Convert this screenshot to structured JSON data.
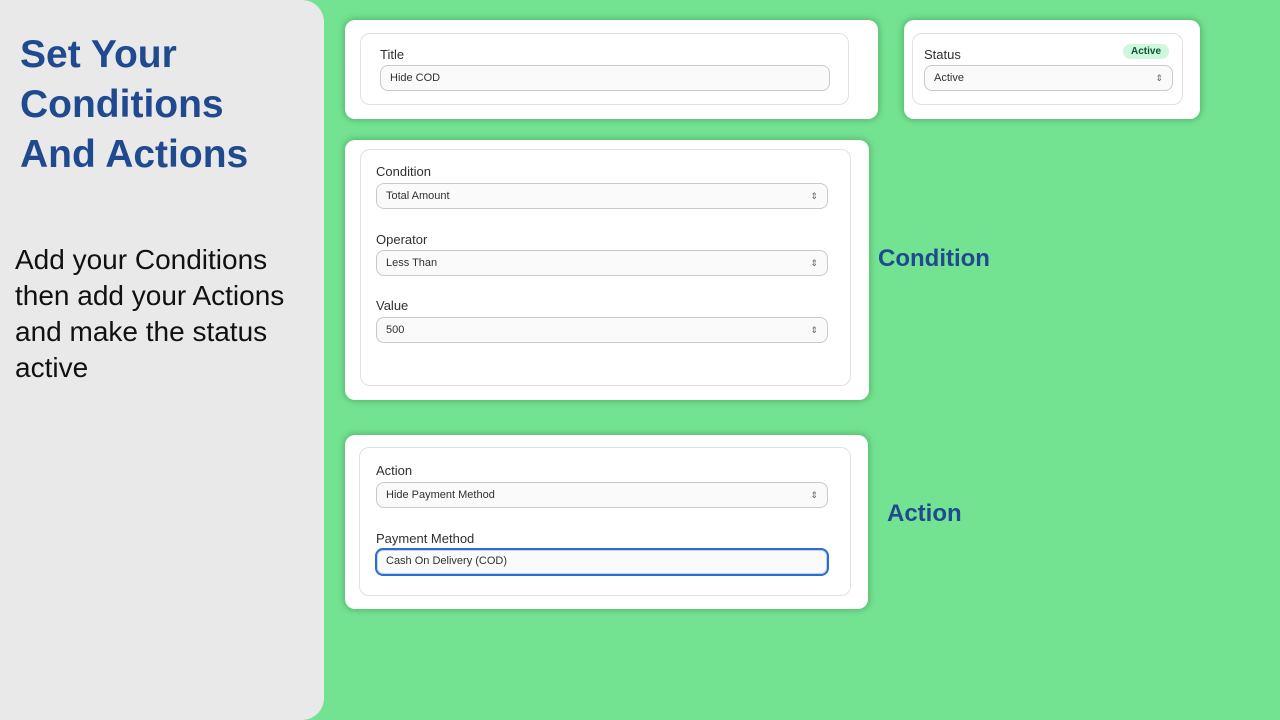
{
  "intro": {
    "heading_lines": [
      "Set Your",
      "Conditions",
      "And Actions"
    ],
    "description": "Add your Conditions then add your Actions and make the status active"
  },
  "title_card": {
    "label": "Title",
    "value": "Hide COD"
  },
  "status_card": {
    "label": "Status",
    "badge": "Active",
    "value": "Active",
    "badge_color": "#cdf8dd"
  },
  "condition_card": {
    "side_label": "Condition",
    "fields": [
      {
        "label": "Condition",
        "value": "Total Amount"
      },
      {
        "label": "Operator",
        "value": "Less Than"
      },
      {
        "label": "Value",
        "value": "500"
      }
    ]
  },
  "action_card": {
    "side_label": "Action",
    "action": {
      "label": "Action",
      "value": "Hide Payment Method"
    },
    "payment": {
      "label": "Payment Method",
      "value": "Cash On Delivery (COD)"
    }
  },
  "colors": {
    "background": "#74e391",
    "heading": "#1f4a8f",
    "focus": "#2c6ecb"
  }
}
